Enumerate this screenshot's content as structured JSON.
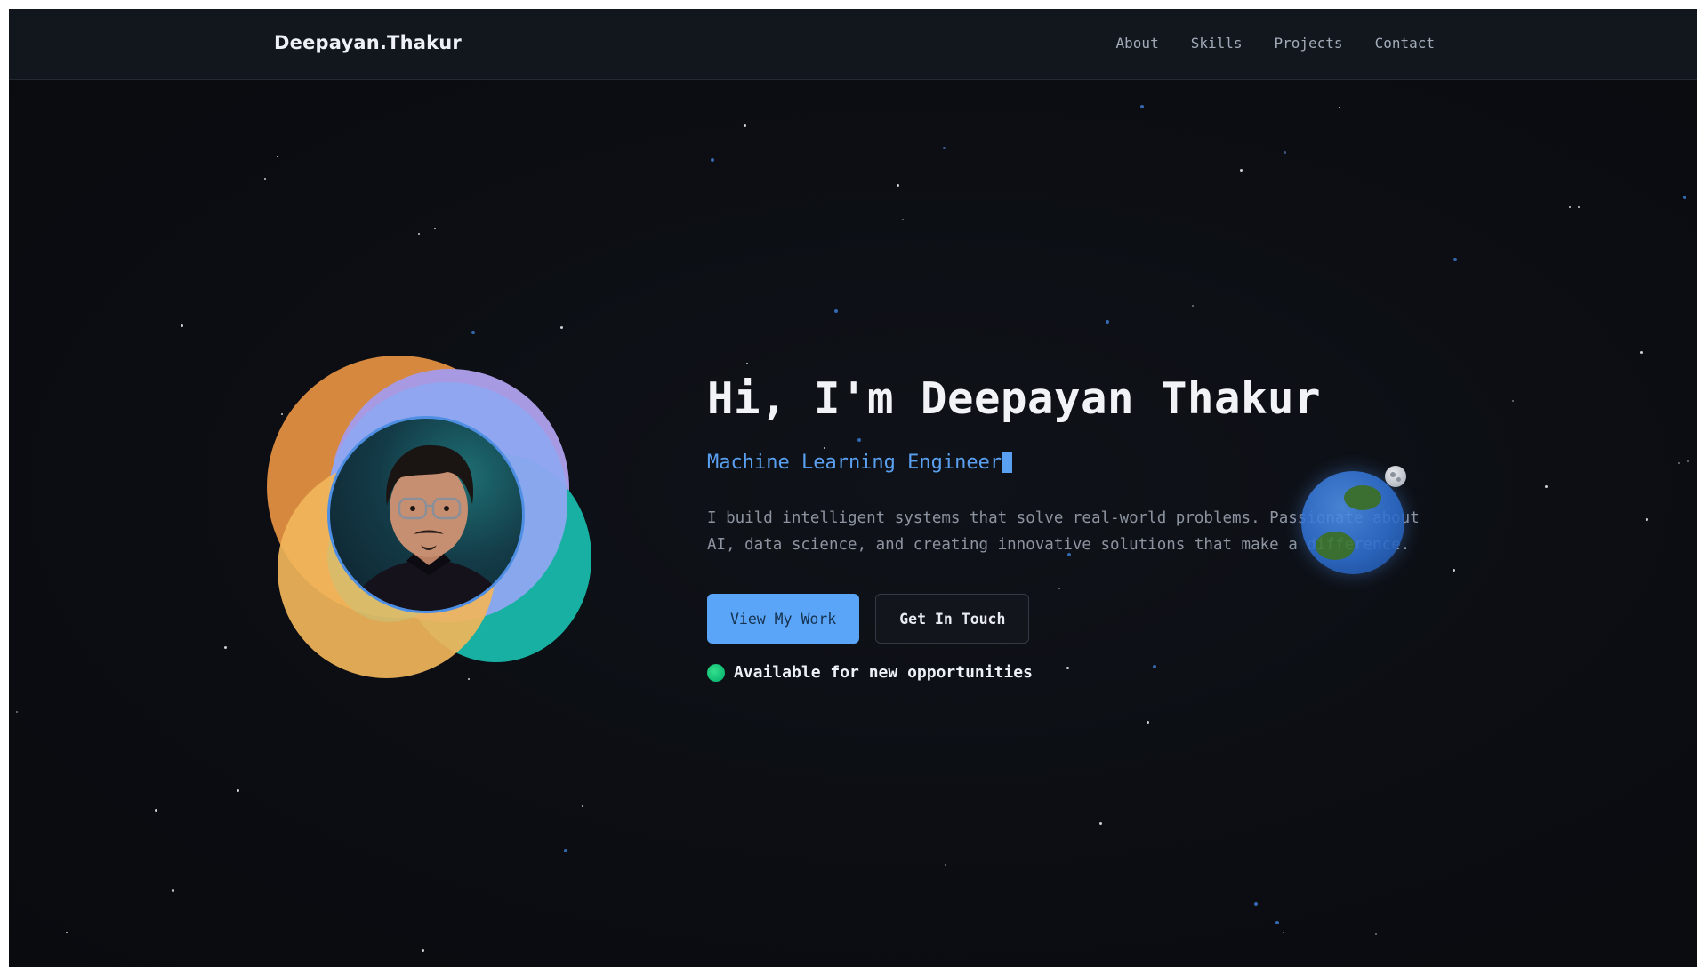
{
  "navbar": {
    "brand": "Deepayan.Thakur",
    "links": [
      {
        "label": "About"
      },
      {
        "label": "Skills"
      },
      {
        "label": "Projects"
      },
      {
        "label": "Contact"
      }
    ]
  },
  "hero": {
    "title": "Hi, I'm Deepayan Thakur",
    "role": "Machine Learning Engineer",
    "description": "I build intelligent systems that solve real-world problems. Passionate about AI, data science, and creating innovative solutions that make a difference.",
    "primary_button": "View My Work",
    "secondary_button": "Get In Touch",
    "status": "Available for new opportunities"
  },
  "colors": {
    "background": "#0b0d12",
    "accent": "#5aa5f8",
    "status_green": "#14c178"
  },
  "icons": {
    "globe": "earth-icon",
    "moon": "moon-icon",
    "status": "status-dot-icon"
  }
}
